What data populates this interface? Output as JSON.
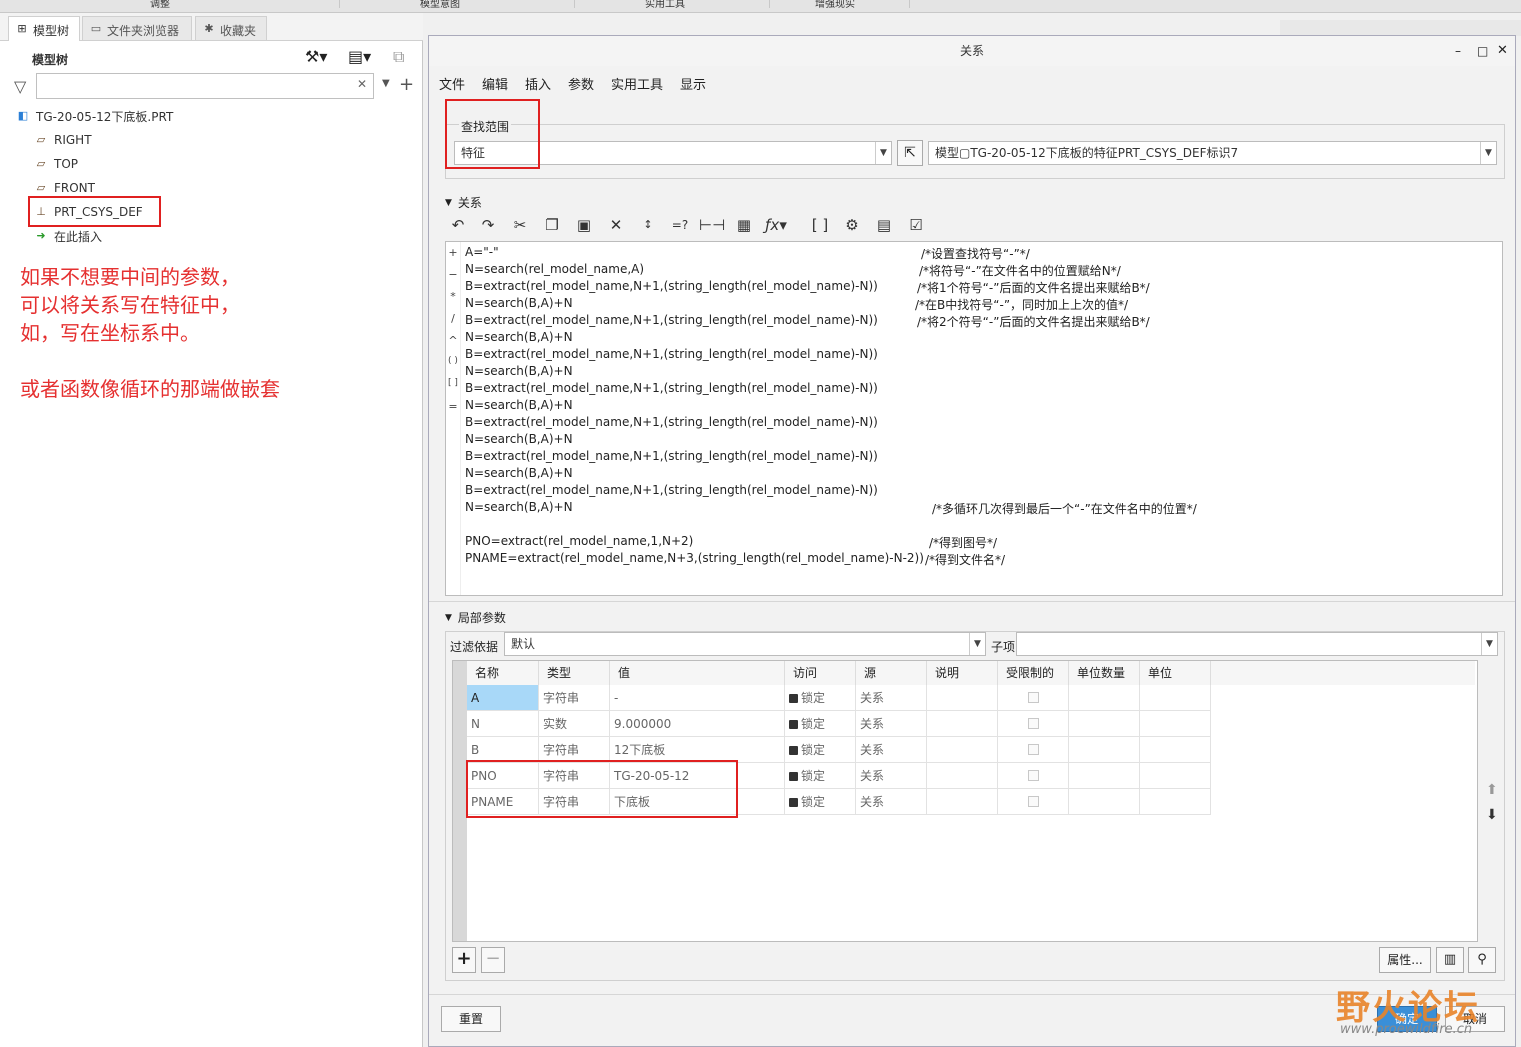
{
  "top_strip": [
    "调整",
    "模型意图",
    "实用工具",
    "增强现实"
  ],
  "left": {
    "tabs": [
      "模型树",
      "文件夹浏览器",
      "收藏夹"
    ],
    "tree_title": "模型树",
    "tree": [
      {
        "label": "TG-20-05-12下底板.PRT"
      },
      {
        "label": "RIGHT"
      },
      {
        "label": "TOP"
      },
      {
        "label": "FRONT"
      },
      {
        "label": "PRT_CSYS_DEF"
      },
      {
        "label": "在此插入"
      }
    ],
    "note_lines": [
      "如果不想要中间的参数，",
      "可以将关系写在特征中，",
      "如，写在坐标系中。",
      "",
      "或者函数像循环的那端做嵌套"
    ]
  },
  "dialog": {
    "title": "关系",
    "menu": [
      "文件",
      "编辑",
      "插入",
      "参数",
      "实用工具",
      "显示"
    ],
    "scope_label": "查找范围",
    "scope_value": "特征",
    "scope_target": "模型▢TG-20-05-12下底板的特征PRT_CSYS_DEF标识7",
    "rel_section": "关系",
    "ops": [
      "+",
      "−",
      "*",
      "/",
      "^",
      "( )",
      "[ ]",
      "="
    ],
    "code": [
      "A=\"-\"",
      "N=search(rel_model_name,A)",
      "B=extract(rel_model_name,N+1,(string_length(rel_model_name)-N))",
      "N=search(B,A)+N",
      "B=extract(rel_model_name,N+1,(string_length(rel_model_name)-N))",
      "N=search(B,A)+N",
      "B=extract(rel_model_name,N+1,(string_length(rel_model_name)-N))",
      "N=search(B,A)+N",
      "B=extract(rel_model_name,N+1,(string_length(rel_model_name)-N))",
      "N=search(B,A)+N",
      "B=extract(rel_model_name,N+1,(string_length(rel_model_name)-N))",
      "N=search(B,A)+N",
      "B=extract(rel_model_name,N+1,(string_length(rel_model_name)-N))",
      "N=search(B,A)+N",
      "B=extract(rel_model_name,N+1,(string_length(rel_model_name)-N))",
      "N=search(B,A)+N",
      "",
      "PNO=extract(rel_model_name,1,N+2)",
      "PNAME=extract(rel_model_name,N+3,(string_length(rel_model_name)-N-2))"
    ],
    "comments": [
      "/*设置查找符号“-”*/",
      "/*将符号“-”在文件名中的位置赋给N*/",
      "/*将1个符号“-”后面的文件名提出来赋给B*/",
      "/*在B中找符号“-”，同时加上上次的值*/",
      "/*将2个符号“-”后面的文件名提出来赋给B*/",
      "/*多循环几次得到最后一个“-”在文件名中的位置*/",
      "/*得到图号*/",
      "/*得到文件名*/"
    ],
    "local_section": "局部参数",
    "filter_label": "过滤依据",
    "filter_value": "默认",
    "child_label": "子项",
    "child_value": "",
    "columns": [
      "名称",
      "类型",
      "值",
      "访问",
      "源",
      "说明",
      "受限制的",
      "单位数量",
      "单位"
    ],
    "rows": [
      [
        "A",
        "字符串",
        "-",
        "锁定",
        "关系"
      ],
      [
        "N",
        "实数",
        "9.000000",
        "锁定",
        "关系"
      ],
      [
        "B",
        "字符串",
        "12下底板",
        "锁定",
        "关系"
      ],
      [
        "PNO",
        "字符串",
        "TG-20-05-12",
        "锁定",
        "关系"
      ],
      [
        "PNAME",
        "字符串",
        "下底板",
        "锁定",
        "关系"
      ]
    ],
    "props_btn": "属性...",
    "reset_btn": "重置",
    "ok_btn": "确定",
    "cancel_btn": "取消"
  },
  "watermark": {
    "text": "野火论坛",
    "url": "www.proewildfire.cn"
  },
  "colors": {
    "annotation": "#e02020",
    "note": "#e53030"
  }
}
